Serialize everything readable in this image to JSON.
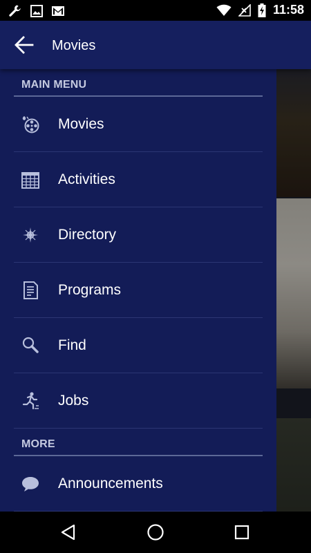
{
  "status_bar": {
    "time": "11:58",
    "left_icons": [
      "wrench-icon",
      "image-icon",
      "gmail-icon"
    ],
    "right_icons": [
      "wifi-icon",
      "no-signal-icon",
      "battery-charging-icon"
    ]
  },
  "toolbar": {
    "title": "Movies",
    "back_icon": "arrow-left-icon"
  },
  "drawer": {
    "main_menu_header": "MAIN MENU",
    "items": [
      {
        "label": "Movies",
        "icon": "film-reel-icon"
      },
      {
        "label": "Activities",
        "icon": "calendar-icon"
      },
      {
        "label": "Directory",
        "icon": "compass-icon"
      },
      {
        "label": "Programs",
        "icon": "document-icon"
      },
      {
        "label": "Find",
        "icon": "search-icon"
      },
      {
        "label": "Jobs",
        "icon": "runner-icon"
      }
    ],
    "more_header": "MORE",
    "more_items": [
      {
        "label": "Announcements",
        "icon": "speech-bubble-icon"
      }
    ]
  },
  "nav_bar": {
    "buttons": [
      "back-triangle-icon",
      "home-circle-icon",
      "recents-square-icon"
    ]
  },
  "colors": {
    "toolbar": "#151f5e",
    "drawer": "#131c57",
    "divider": "#2c3674",
    "header_line": "#5d6897",
    "header_text": "#c5cae0",
    "icon": "#b8bfdc"
  }
}
